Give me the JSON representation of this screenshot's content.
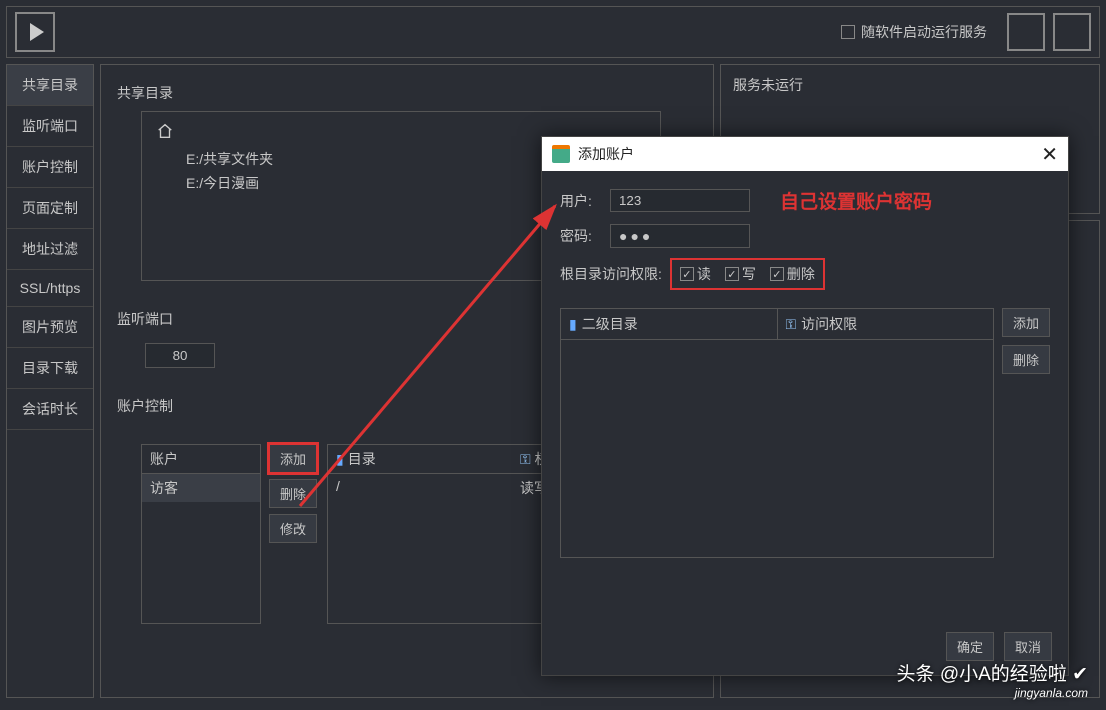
{
  "topbar": {
    "auto_run_label": "随软件启动运行服务"
  },
  "sidebar": {
    "items": [
      {
        "label": "共享目录"
      },
      {
        "label": "监听端口"
      },
      {
        "label": "账户控制"
      },
      {
        "label": "页面定制"
      },
      {
        "label": "地址过滤"
      },
      {
        "label": "SSL/https"
      },
      {
        "label": "图片预览"
      },
      {
        "label": "目录下载"
      },
      {
        "label": "会话时长"
      }
    ]
  },
  "share": {
    "section_label": "共享目录",
    "tree": {
      "items": [
        "E:/共享文件夹",
        "E:/今日漫画"
      ]
    }
  },
  "port": {
    "section_label": "监听端口",
    "value": "80"
  },
  "account_ctrl": {
    "section_label": "账户控制",
    "list_header": "账户",
    "list_item": "访客",
    "buttons": {
      "add": "添加",
      "del": "删除",
      "mod": "修改"
    },
    "dir_header": "目录",
    "perm_header": "权限",
    "dir_val": "/",
    "perm_val": "读写"
  },
  "status": {
    "text": "服务未运行"
  },
  "modal": {
    "title": "添加账户",
    "user_label": "用户:",
    "user_value": "123",
    "pwd_label": "密码:",
    "pwd_value": "●●●",
    "annot": "自己设置账户密码",
    "root_perm_label": "根目录访问权限:",
    "perms": {
      "read": "读",
      "write": "写",
      "del": "删除"
    },
    "sub_col1": "二级目录",
    "sub_col2": "访问权限",
    "side_add": "添加",
    "side_del": "删除",
    "ok": "确定",
    "cancel": "取消"
  },
  "watermark": {
    "line1": "头条 @小A的经验啦 ✔",
    "line2": "jingyanla.com"
  }
}
